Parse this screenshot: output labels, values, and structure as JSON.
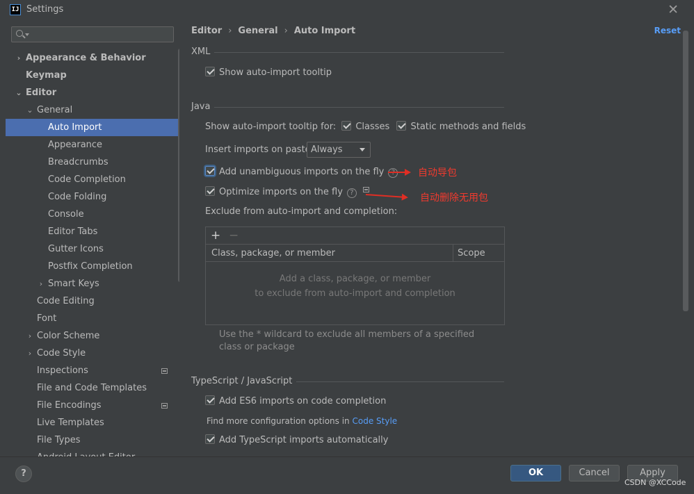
{
  "window": {
    "title": "Settings",
    "app_icon_text": "IJ"
  },
  "search": {
    "placeholder": "",
    "value": ""
  },
  "sidebar": {
    "items": [
      {
        "label": "Appearance & Behavior",
        "level": 0,
        "arrow": "›",
        "bold": true
      },
      {
        "label": "Keymap",
        "level": 0,
        "arrow": "",
        "bold": true
      },
      {
        "label": "Editor",
        "level": 0,
        "arrow": "⌄",
        "bold": true
      },
      {
        "label": "General",
        "level": 1,
        "arrow": "⌄"
      },
      {
        "label": "Auto Import",
        "level": 2,
        "arrow": "",
        "selected": true
      },
      {
        "label": "Appearance",
        "level": 2,
        "arrow": ""
      },
      {
        "label": "Breadcrumbs",
        "level": 2,
        "arrow": ""
      },
      {
        "label": "Code Completion",
        "level": 2,
        "arrow": ""
      },
      {
        "label": "Code Folding",
        "level": 2,
        "arrow": ""
      },
      {
        "label": "Console",
        "level": 2,
        "arrow": ""
      },
      {
        "label": "Editor Tabs",
        "level": 2,
        "arrow": ""
      },
      {
        "label": "Gutter Icons",
        "level": 2,
        "arrow": ""
      },
      {
        "label": "Postfix Completion",
        "level": 2,
        "arrow": ""
      },
      {
        "label": "Smart Keys",
        "level": 2,
        "arrow": "›"
      },
      {
        "label": "Code Editing",
        "level": 1,
        "arrow": ""
      },
      {
        "label": "Font",
        "level": 1,
        "arrow": ""
      },
      {
        "label": "Color Scheme",
        "level": 1,
        "arrow": "›"
      },
      {
        "label": "Code Style",
        "level": 1,
        "arrow": "›"
      },
      {
        "label": "Inspections",
        "level": 1,
        "arrow": "",
        "badge": true
      },
      {
        "label": "File and Code Templates",
        "level": 1,
        "arrow": ""
      },
      {
        "label": "File Encodings",
        "level": 1,
        "arrow": "",
        "badge": true
      },
      {
        "label": "Live Templates",
        "level": 1,
        "arrow": ""
      },
      {
        "label": "File Types",
        "level": 1,
        "arrow": ""
      },
      {
        "label": "Android Layout Editor",
        "level": 1,
        "arrow": ""
      }
    ]
  },
  "breadcrumb": {
    "part1": "Editor",
    "part2": "General",
    "part3": "Auto Import",
    "sep": "›"
  },
  "reset_label": "Reset",
  "xml": {
    "title": "XML",
    "show_tooltip": {
      "label": "Show auto-import tooltip",
      "checked": true
    }
  },
  "java": {
    "title": "Java",
    "tooltip_for_label": "Show auto-import tooltip for:",
    "classes": {
      "label": "Classes",
      "checked": true
    },
    "static_methods": {
      "label": "Static methods and fields",
      "checked": true
    },
    "insert_on_paste_label": "Insert imports on paste:",
    "insert_on_paste_value": "Always",
    "add_unambiguous": {
      "label": "Add unambiguous imports on the fly",
      "checked": true
    },
    "optimize": {
      "label": "Optimize imports on the fly",
      "checked": true
    },
    "exclude_label": "Exclude from auto-import and completion:",
    "table": {
      "add": "+",
      "remove": "−",
      "col1": "Class, package, or member",
      "col2": "Scope",
      "empty_line1": "Add a class, package, or member",
      "empty_line2": "to exclude from auto-import and completion"
    },
    "wildcard_hint": "Use the * wildcard to exclude all members of a specified class or package"
  },
  "annotations": {
    "auto_import_cn": "自动导包",
    "auto_remove_cn": "自动删除无用包",
    "color": "#f03a2e"
  },
  "typescript": {
    "title": "TypeScript / JavaScript",
    "es6": {
      "label": "Add ES6 imports on code completion",
      "checked": true
    },
    "more_options_text": "Find more configuration options in",
    "code_style_link": "Code Style",
    "ts_auto": {
      "label": "Add TypeScript imports automatically",
      "checked": true
    }
  },
  "buttons": {
    "help": "?",
    "ok": "OK",
    "cancel": "Cancel",
    "apply": "Apply"
  },
  "watermark": "CSDN @XCCode",
  "colors": {
    "selected": "#4b6eaf",
    "link": "#589df6",
    "ok_button": "#365880",
    "background": "#3c3f41"
  }
}
